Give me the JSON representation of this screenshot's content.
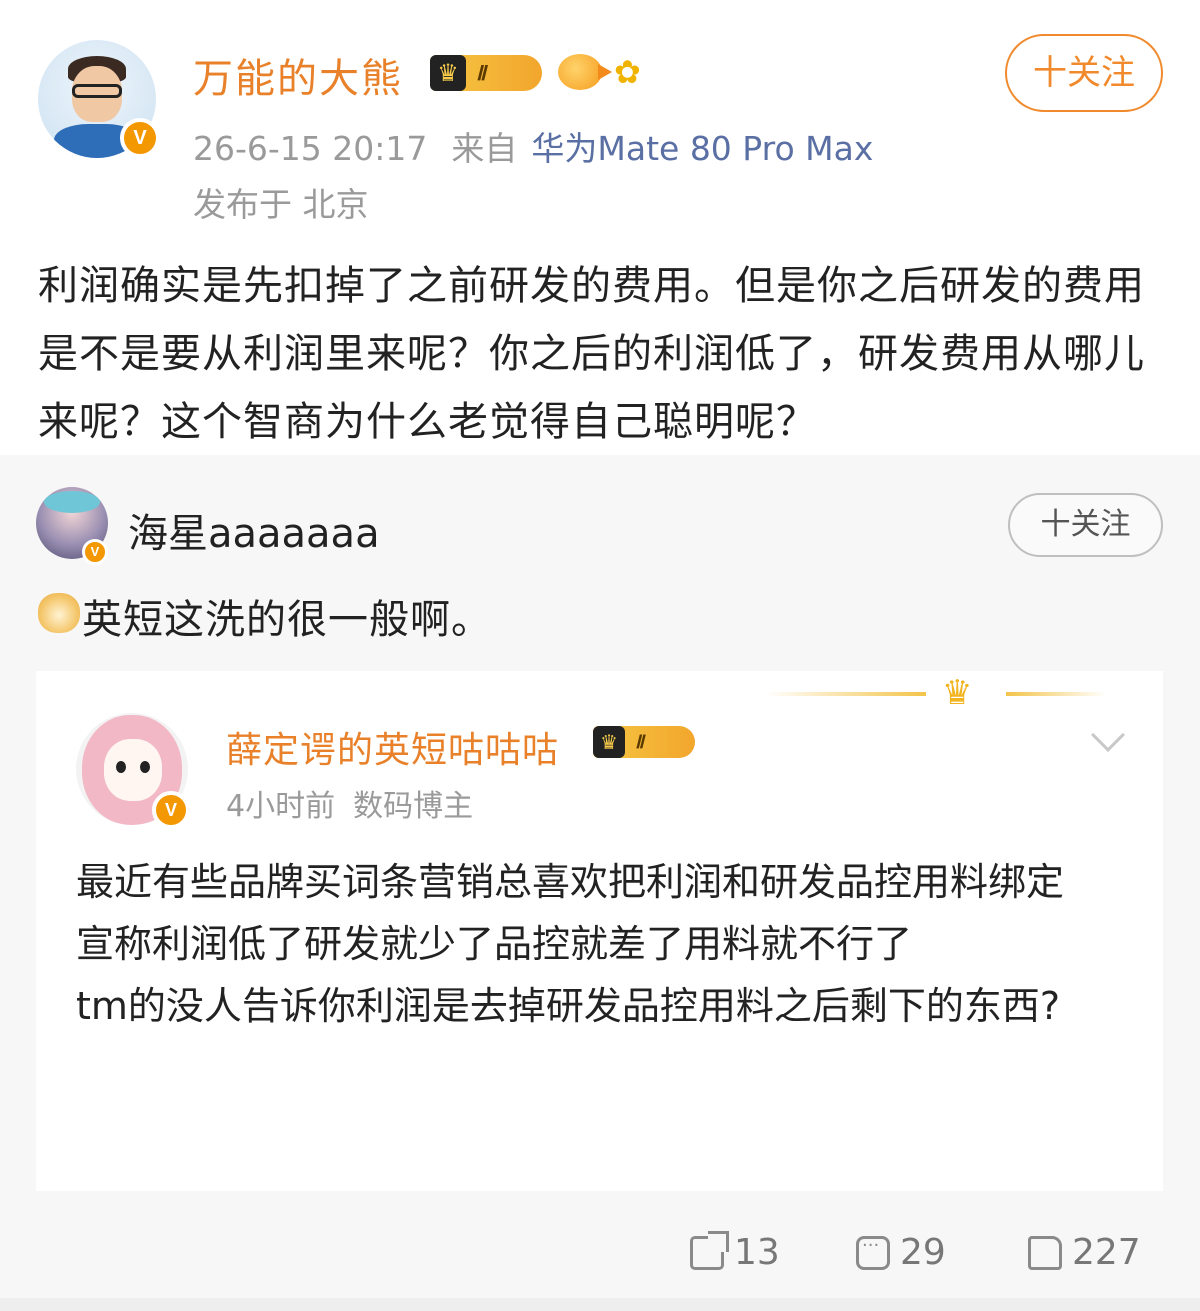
{
  "post": {
    "username": "万能的大熊",
    "level_badge": "Ⅱ",
    "follow_label": "十关注",
    "time": "26-6-15 20:17",
    "source_prefix": "来自",
    "device": "华为Mate 80 Pro Max",
    "location": "发布于 北京",
    "text": "利润确实是先扣掉了之前研发的费用。但是你之后研发的费用是不是要从利润里来呢？你之后的利润低了，研发费用从哪儿来呢？这个智商为什么老觉得自己聪明呢？"
  },
  "repost": {
    "username": "海星aaaaaaa",
    "follow_label": "十关注",
    "text": "英短这洗的很一般啊。"
  },
  "quoted": {
    "username": "薛定谔的英短咕咕咕",
    "level_badge": "Ⅱ",
    "time": "4小时前",
    "role": "数码博主",
    "lines": [
      "最近有些品牌买词条营销总喜欢把利润和研发品控用料绑定",
      "宣称利润低了研发就少了品控就差了用料就不行了",
      "tm的没人告诉你利润是去掉研发品控用料之后剩下的东西?"
    ]
  },
  "actions": {
    "shares": "13",
    "comments": "29",
    "likes": "227"
  },
  "colors": {
    "accent_orange": "#e8812a",
    "device_blue": "#5a6fa3",
    "verified_badge": "#f39800"
  },
  "icons": [
    "crown-icon",
    "fish-icon",
    "flower-icon",
    "doge-icon",
    "chevron-down-icon",
    "share-icon",
    "comment-icon",
    "like-icon"
  ]
}
